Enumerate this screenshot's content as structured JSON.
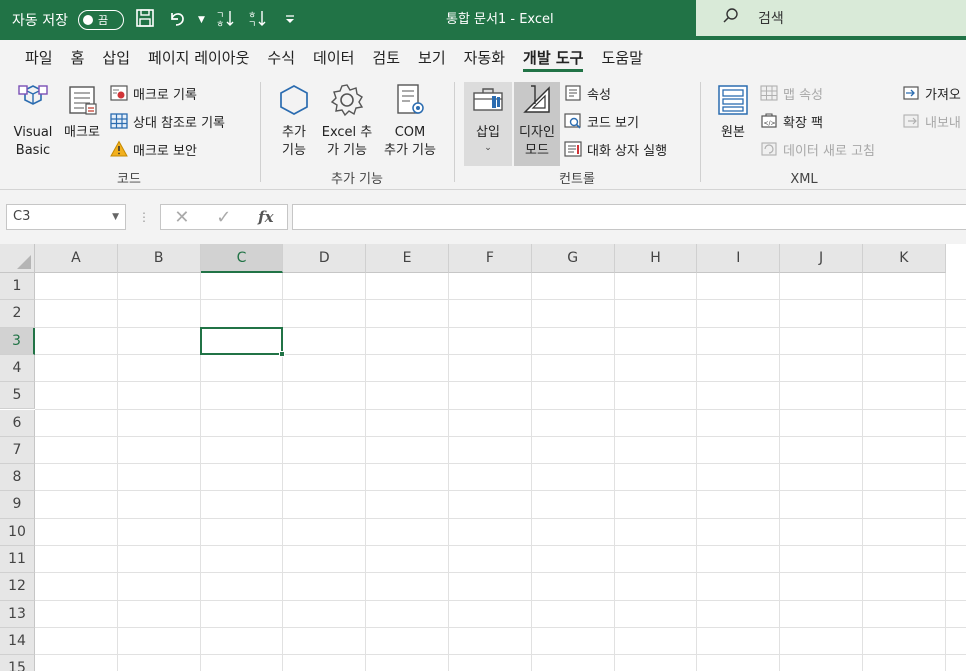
{
  "titlebar": {
    "autosave_label": "자동 저장",
    "autosave_state": "끔",
    "doc_title": "통합 문서1  -  Excel",
    "search_placeholder": "검색",
    "colors": {
      "bar": "#217346",
      "search": "#d9ead8"
    }
  },
  "tabs": [
    {
      "label": "파일",
      "active": false
    },
    {
      "label": "홈",
      "active": false
    },
    {
      "label": "삽입",
      "active": false
    },
    {
      "label": "페이지 레이아웃",
      "active": false
    },
    {
      "label": "수식",
      "active": false
    },
    {
      "label": "데이터",
      "active": false
    },
    {
      "label": "검토",
      "active": false
    },
    {
      "label": "보기",
      "active": false
    },
    {
      "label": "자동화",
      "active": false
    },
    {
      "label": "개발 도구",
      "active": true
    },
    {
      "label": "도움말",
      "active": false
    }
  ],
  "ribbon": {
    "code": {
      "label": "코드",
      "visual_basic": "Visual\nBasic",
      "macro": "매크로",
      "record_macro": "매크로 기록",
      "relative_ref": "상대 참조로 기록",
      "macro_security": "매크로 보안"
    },
    "addins": {
      "label": "추가 기능",
      "addins": "추가\n기능",
      "excel_addins": "Excel 추\n가 기능",
      "com_addins": "COM\n추가 기능"
    },
    "controls": {
      "label": "컨트롤",
      "insert": "삽입",
      "design_mode": "디자인\n모드",
      "properties": "속성",
      "view_code": "코드 보기",
      "run_dialog": "대화 상자 실행"
    },
    "xml": {
      "label": "XML",
      "source": "원본",
      "map_properties": "맵 속성",
      "expansion_packs": "확장 팩",
      "refresh_data": "데이터 새로 고침",
      "import": "가져오",
      "export": "내보내"
    }
  },
  "formula_bar": {
    "name_box": "C3",
    "fx": "fx",
    "formula": ""
  },
  "sheet": {
    "columns": [
      "A",
      "B",
      "C",
      "D",
      "E",
      "F",
      "G",
      "H",
      "I",
      "J",
      "K"
    ],
    "rows": [
      "1",
      "2",
      "3",
      "4",
      "5",
      "6",
      "7",
      "8",
      "9",
      "10",
      "11",
      "12",
      "13",
      "14",
      "15"
    ],
    "active_cell": "C3",
    "active_color": "#217346"
  }
}
